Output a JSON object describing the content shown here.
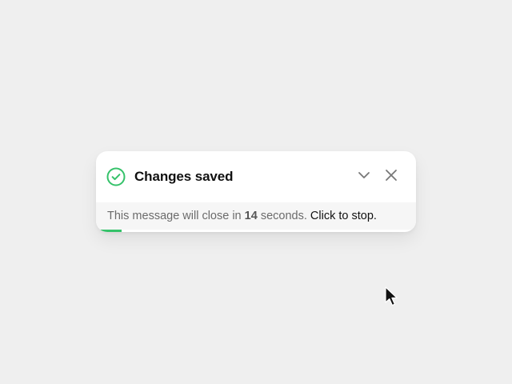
{
  "toast": {
    "title": "Changes saved",
    "status": "success",
    "message_prefix": "This message will close in",
    "countdown_seconds": "14",
    "message_suffix": "seconds.",
    "stop_label": "Click to stop.",
    "progress": 0.08,
    "icons": {
      "status": "check-circle-icon",
      "collapse": "chevron-down-icon",
      "close": "close-icon"
    }
  },
  "colors": {
    "background": "#efefef",
    "card": "#ffffff",
    "footer": "#f6f6f6",
    "accent_success": "#35c26a",
    "title_text": "#111111",
    "muted_text": "#6b6b6b"
  }
}
